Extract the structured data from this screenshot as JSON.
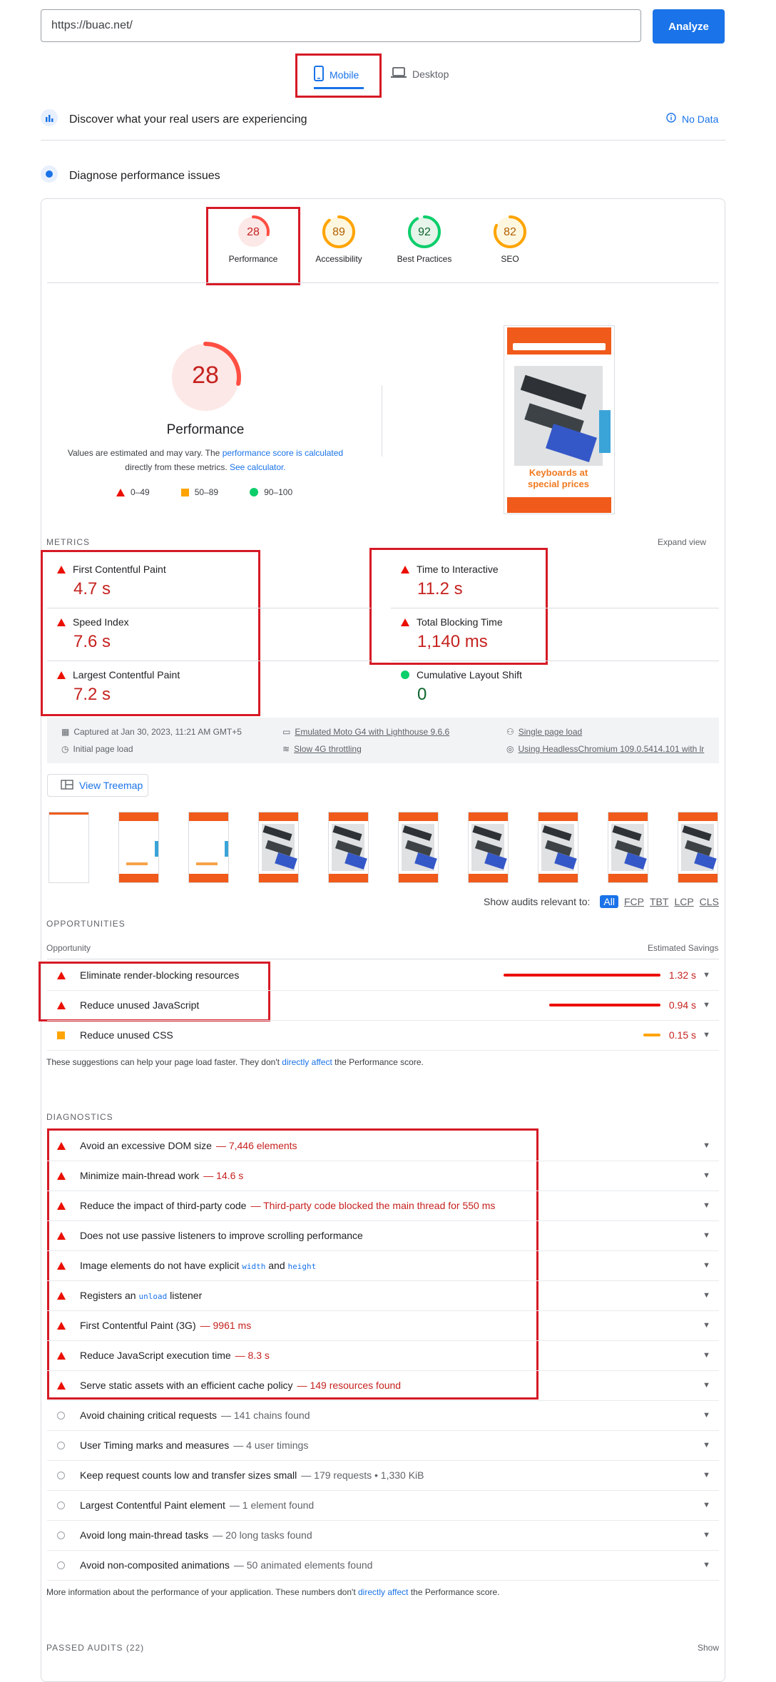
{
  "url_input": {
    "value": "https://buac.net/"
  },
  "analyze_label": "Analyze",
  "tabs": {
    "mobile": "Mobile",
    "desktop": "Desktop"
  },
  "discover": {
    "text": "Discover what your real users are experiencing",
    "no_data": "No Data"
  },
  "diagnose": {
    "text": "Diagnose performance issues"
  },
  "categories": [
    {
      "score": "28",
      "label": "Performance",
      "fraction": 0.28,
      "color": "#c5221f"
    },
    {
      "score": "89",
      "label": "Accessibility",
      "fraction": 0.89,
      "color": "#b06000"
    },
    {
      "score": "92",
      "label": "Best Practices",
      "fraction": 0.92,
      "color": "#0d652d"
    },
    {
      "score": "82",
      "label": "SEO",
      "fraction": 0.82,
      "color": "#b06000"
    }
  ],
  "big_gauge": {
    "score": "28",
    "label": "Performance"
  },
  "estimate_note": {
    "prefix": "Values are estimated and may vary. The",
    "link1": "performance score is calculated",
    "middle": "directly from these metrics.",
    "link2": "See calculator."
  },
  "legend": {
    "bad": "0–49",
    "avg": "50–89",
    "good": "90–100"
  },
  "screenshot_text": "Keyboards at special prices",
  "metrics_header": "METRICS",
  "expand_view": "Expand view",
  "metrics": {
    "fcp": {
      "name": "First Contentful Paint",
      "value": "4.7 s"
    },
    "si": {
      "name": "Speed Index",
      "value": "7.6 s"
    },
    "lcp": {
      "name": "Largest Contentful Paint",
      "value": "7.2 s"
    },
    "tti": {
      "name": "Time to Interactive",
      "value": "11.2 s"
    },
    "tbt": {
      "name": "Total Blocking Time",
      "value": "1,140 ms"
    },
    "cls": {
      "name": "Cumulative Layout Shift",
      "value": "0"
    }
  },
  "environment": {
    "captured": "Captured at Jan 30, 2023, 11:21 AM GMT+5",
    "initial": "Initial page load",
    "emulated": "Emulated Moto G4 with Lighthouse 9.6.6",
    "throttling": "Slow 4G throttling",
    "single": "Single page load",
    "browser": "Using HeadlessChromium 109.0.5414.101 with lr"
  },
  "view_treemap": "View Treemap",
  "filter": {
    "label": "Show audits relevant to:",
    "all": "All",
    "fcp": "FCP",
    "tbt": "TBT",
    "lcp": "LCP",
    "cls": "CLS"
  },
  "opportunities": {
    "header": "OPPORTUNITIES",
    "col_left": "Opportunity",
    "col_right": "Estimated Savings",
    "items": [
      {
        "title": "Eliminate render-blocking resources",
        "savings": "1.32 s",
        "fraction": 1.0
      },
      {
        "title": "Reduce unused JavaScript",
        "savings": "0.94 s",
        "fraction": 0.71
      },
      {
        "title": "Reduce unused CSS",
        "savings": "0.15 s",
        "fraction": 0.11
      }
    ],
    "note_prefix": "These suggestions can help your page load faster. They don't",
    "note_link": "directly affect",
    "note_suffix": "the Performance score."
  },
  "diagnostics": {
    "header": "DIAGNOSTICS",
    "items": [
      {
        "title": "Avoid an excessive DOM size",
        "detail": "— 7,446 elements"
      },
      {
        "title": "Minimize main-thread work",
        "detail": "— 14.6 s"
      },
      {
        "title": "Reduce the impact of third-party code",
        "detail": "— Third-party code blocked the main thread for 550 ms"
      },
      {
        "title": "Does not use passive listeners to improve scrolling performance",
        "detail": ""
      },
      {
        "title_a": "Image elements do not have explicit",
        "code1": "width",
        "title_b": "and",
        "code2": "height"
      },
      {
        "title_a": "Registers an",
        "code1": "unload",
        "title_b": "listener"
      },
      {
        "title": "First Contentful Paint (3G)",
        "detail": "— 9961 ms"
      },
      {
        "title": "Reduce JavaScript execution time",
        "detail": "— 8.3 s"
      },
      {
        "title": "Serve static assets with an efficient cache policy",
        "detail": "— 149 resources found"
      },
      {
        "title": "Avoid chaining critical requests",
        "detail": "— 141 chains found"
      },
      {
        "title": "User Timing marks and measures",
        "detail": "— 4 user timings"
      },
      {
        "title": "Keep request counts low and transfer sizes small",
        "detail": "— 179 requests • 1,330 KiB"
      },
      {
        "title": "Largest Contentful Paint element",
        "detail": "— 1 element found"
      },
      {
        "title": "Avoid long main-thread tasks",
        "detail": "— 20 long tasks found"
      },
      {
        "title": "Avoid non-composited animations",
        "detail": "— 50 animated elements found"
      }
    ],
    "note_prefix": "More information about the performance of your application. These numbers don't",
    "note_link": "directly affect",
    "note_suffix": "the Performance score."
  },
  "passed": {
    "label": "PASSED AUDITS",
    "count": "(22)",
    "show": "Show"
  }
}
